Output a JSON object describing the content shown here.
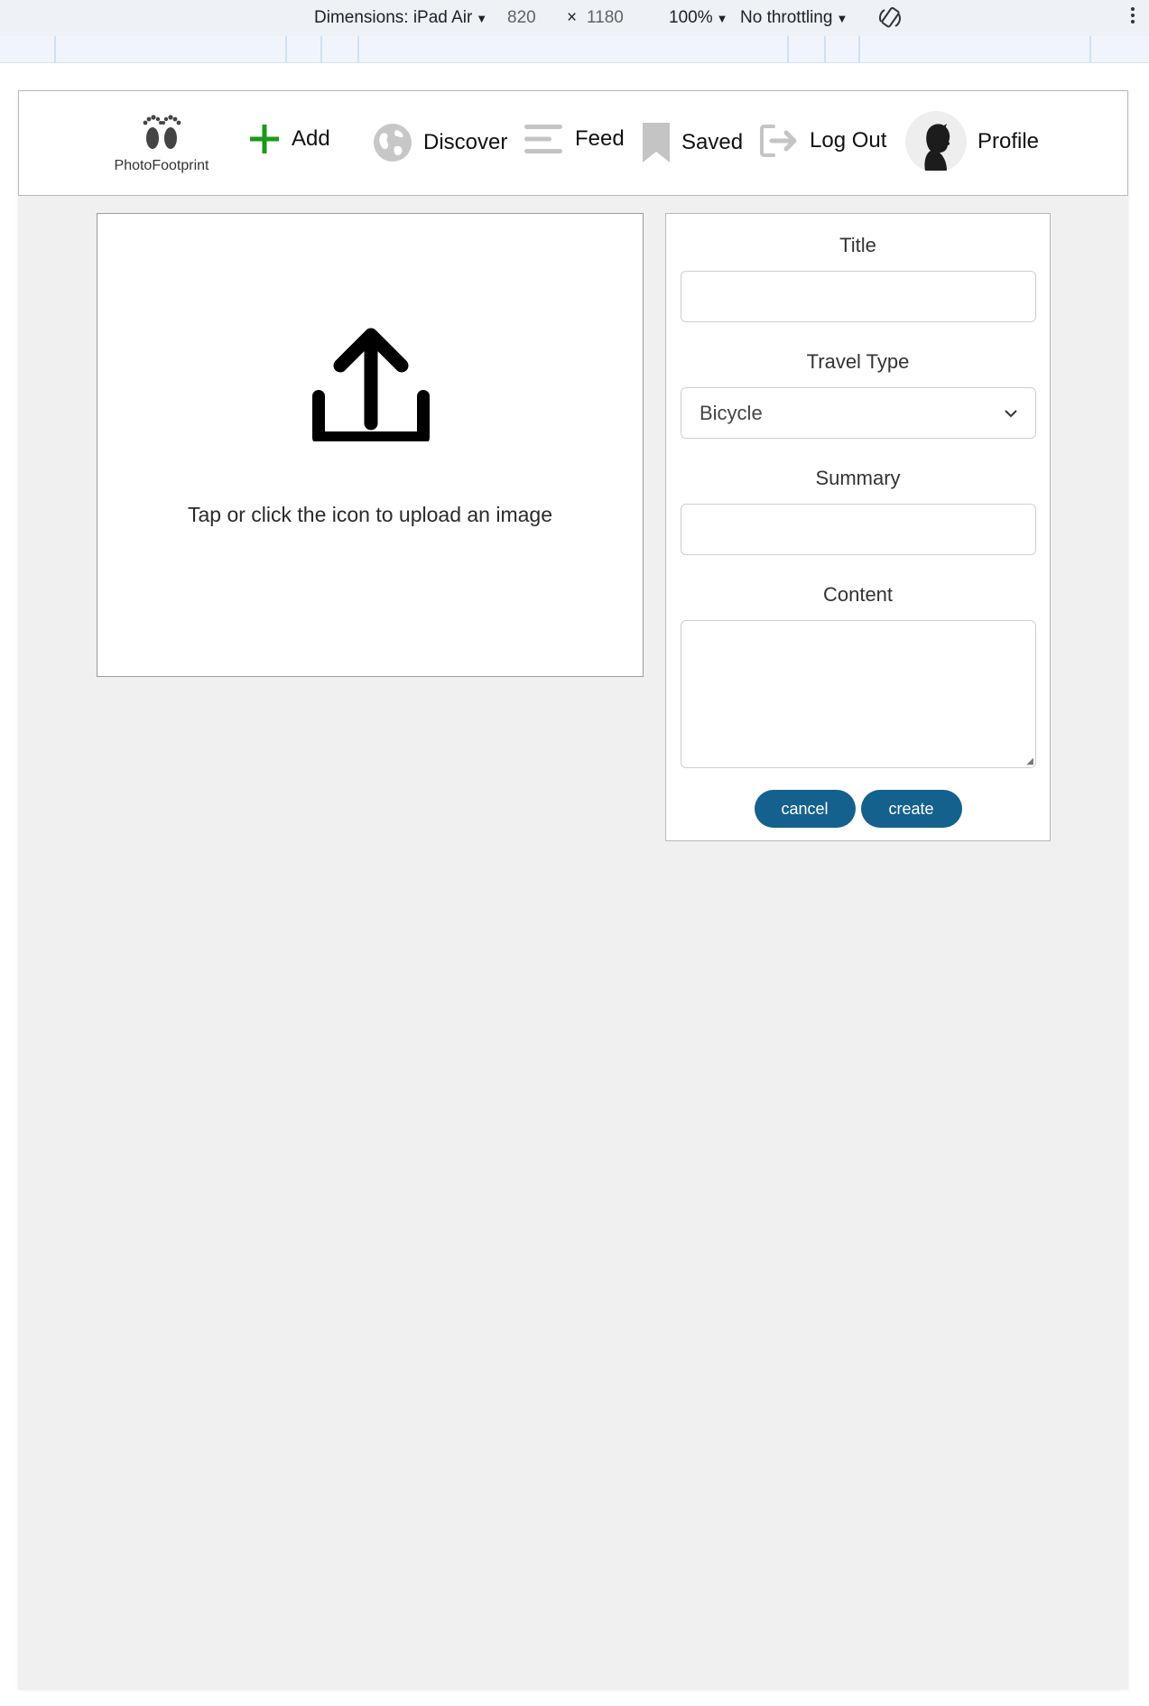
{
  "devtools": {
    "dimensions_label": "Dimensions: iPad Air",
    "width": "820",
    "times": "×",
    "height": "1180",
    "zoom": "100%",
    "throttling": "No throttling"
  },
  "nav": {
    "brand": "PhotoFootprint",
    "add": "Add",
    "discover": "Discover",
    "feed": "Feed",
    "saved": "Saved",
    "logout": "Log Out",
    "profile": "Profile",
    "add_color": "#1a9a1a",
    "icon_gray": "#c4c4c4"
  },
  "upload": {
    "hint": "Tap or click the icon to upload an image"
  },
  "form": {
    "title_label": "Title",
    "title_value": "",
    "travel_type_label": "Travel Type",
    "travel_type_value": "Bicycle",
    "summary_label": "Summary",
    "summary_value": "",
    "content_label": "Content",
    "content_value": "",
    "cancel": "cancel",
    "create": "create",
    "button_color": "#15618e"
  }
}
